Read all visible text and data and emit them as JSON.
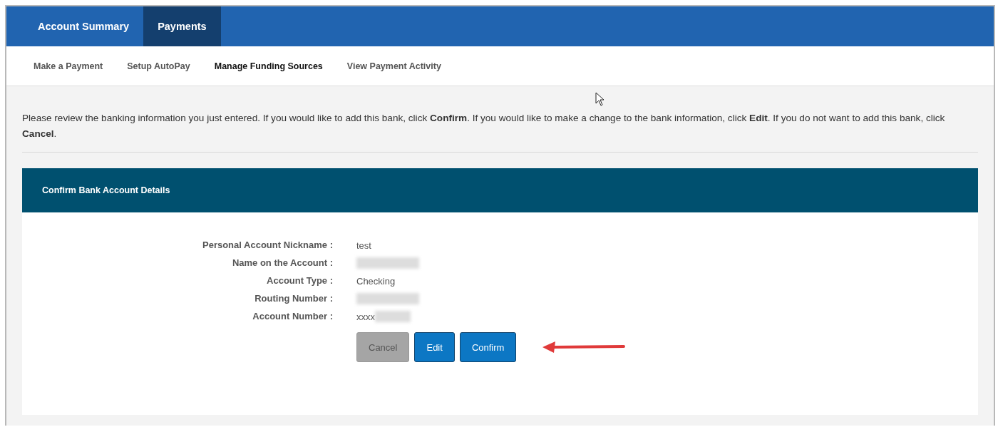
{
  "main_tabs": [
    {
      "label": "Account Summary",
      "selected": false
    },
    {
      "label": "Payments",
      "selected": true
    }
  ],
  "sub_tabs": [
    {
      "label": "Make a Payment",
      "selected": false
    },
    {
      "label": "Setup AutoPay",
      "selected": false
    },
    {
      "label": "Manage Funding Sources",
      "selected": true
    },
    {
      "label": "View Payment Activity",
      "selected": false
    }
  ],
  "intro": "Please review the banking information you just entered. If you would like to add this bank, click **Confirm**. If you would like to make a change to the bank information, click **Edit**. If you do not want to add this bank, click **Cancel**.",
  "panel": {
    "title": "Confirm Bank Account Details",
    "fields": [
      {
        "label": "Personal Account Nickname :",
        "value": "test",
        "redacted": false
      },
      {
        "label": "Name on the Account :",
        "redacted": true
      },
      {
        "label": "Account Type :",
        "value": "Checking",
        "redacted": false
      },
      {
        "label": "Routing Number :",
        "redacted": true
      },
      {
        "label": "Account Number :",
        "value": "xxxx",
        "redacted": true
      }
    ],
    "buttons": [
      {
        "label": "Cancel",
        "kind": "secondary",
        "disabled": true
      },
      {
        "label": "Edit",
        "kind": "primary",
        "disabled": false
      },
      {
        "label": "Confirm",
        "kind": "primary",
        "disabled": false
      }
    ]
  }
}
